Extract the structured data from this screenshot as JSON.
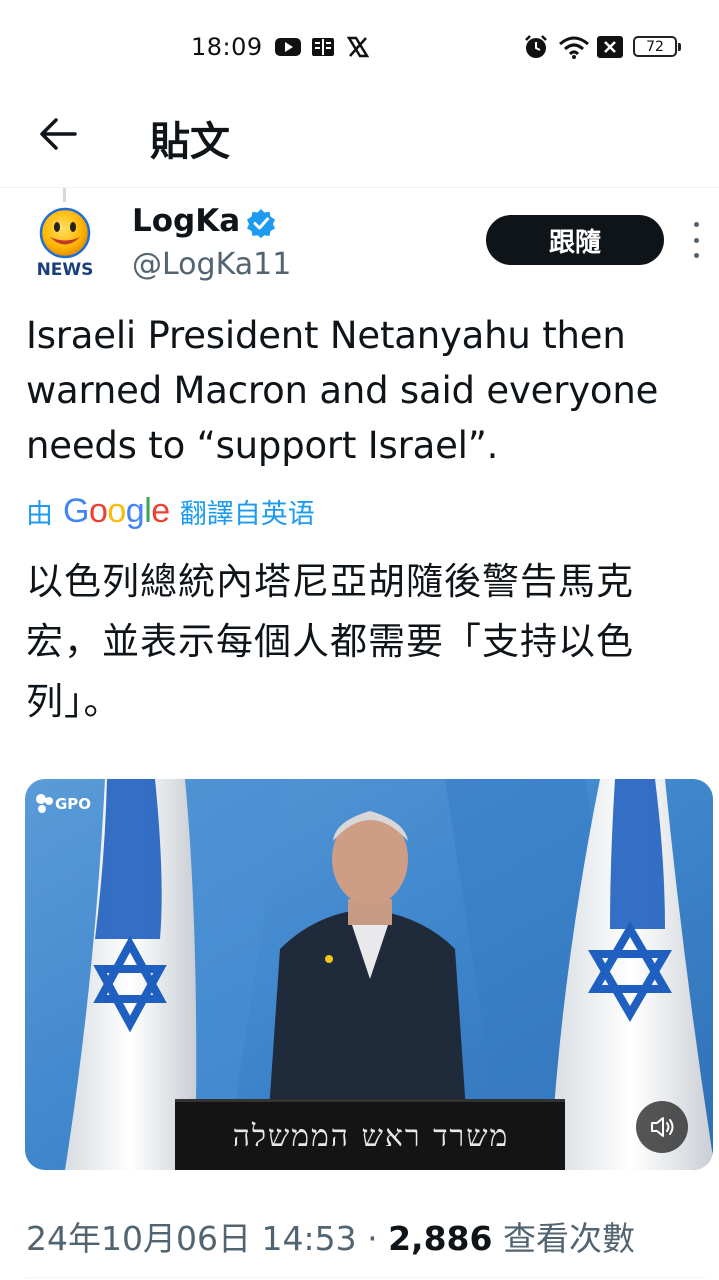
{
  "status_bar": {
    "time": "18:09",
    "icons": [
      "youtube-icon",
      "book-icon",
      "x-logo-icon",
      "alarm-icon",
      "wifi-icon",
      "xbox-icon"
    ],
    "battery": "72"
  },
  "header": {
    "back_icon": "arrow-left-icon",
    "title": "貼文"
  },
  "post": {
    "avatar_text": "NEWS",
    "author_name": "LogKa",
    "verified": true,
    "handle": "@LogKa11",
    "follow_label": "跟隨",
    "more_icon": "vertical-dots-icon",
    "text": "Israeli President Netanyahu then warned Macron and said everyone needs to “support Israel”.",
    "translation": {
      "prefix": "由",
      "provider": "Google",
      "suffix": "翻譯自英语"
    },
    "translated_text": "以色列總統內塔尼亞胡隨後警告馬克宏，並表示每個人都需要「支持以色列」。",
    "media": {
      "watermark": "GPO",
      "podium_text": "משרד ראש הממשלה",
      "volume_icon": "speaker-icon"
    },
    "timestamp": "24年10月06日 14:53",
    "separator": "·",
    "views_count": "2,886",
    "views_label": "查看次數"
  },
  "colors": {
    "accent": "#1d9bf0",
    "text_primary": "#0f1419",
    "text_secondary": "#536471",
    "follow_bg": "#0f1419"
  }
}
